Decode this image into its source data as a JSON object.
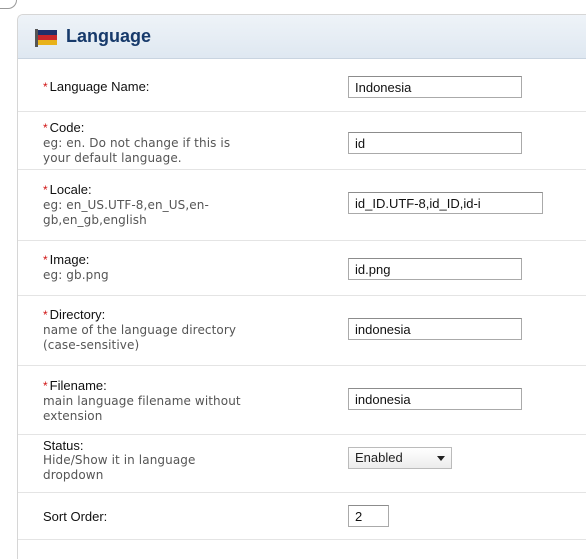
{
  "panel": {
    "title": "Language",
    "icon": "flag-icon"
  },
  "form": {
    "required_mark": "*",
    "language_name": {
      "label": "Language Name:",
      "value": "Indonesia"
    },
    "code": {
      "label": "Code:",
      "hint": "eg: en. Do not change if this is your default language.",
      "hint_line1": "eg: en. Do not change if this is",
      "hint_line2": "your default language.",
      "value": "id"
    },
    "locale": {
      "label": "Locale:",
      "hint_line1": "eg: en_US.UTF-8,en_US,en-",
      "hint_line2": "gb,en_gb,english",
      "value": "id_ID.UTF-8,id_ID,id-i"
    },
    "image": {
      "label": "Image:",
      "hint_line1": "eg: gb.png",
      "value": "id.png"
    },
    "directory": {
      "label": "Directory:",
      "hint_line1": "name of the language directory",
      "hint_line2": "(case-sensitive)",
      "value": "indonesia"
    },
    "filename": {
      "label": "Filename:",
      "hint_line1": "main language filename without",
      "hint_line2": "extension",
      "value": "indonesia"
    },
    "status": {
      "label": "Status:",
      "hint_line1": "Hide/Show it in language",
      "hint_line2": "dropdown",
      "value": "Enabled"
    },
    "sort_order": {
      "label": "Sort Order:",
      "value": "2"
    }
  }
}
